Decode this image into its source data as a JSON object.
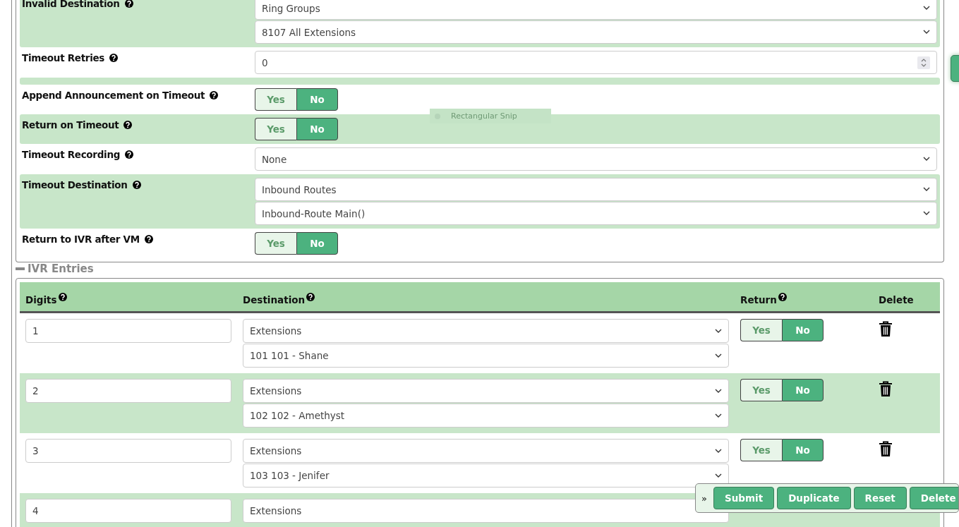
{
  "settings": [
    {
      "kind": "select",
      "label": "Invalid Destination",
      "values": [
        "Ring Groups",
        "8107 All Extensions"
      ]
    },
    {
      "kind": "number",
      "label": "Timeout Retries",
      "value": "0"
    },
    {
      "kind": "blank"
    },
    {
      "kind": "toggle",
      "label": "Append Announcement on Timeout",
      "options": [
        {
          "label": "Yes",
          "selected": false
        },
        {
          "label": "No",
          "selected": true
        }
      ]
    },
    {
      "kind": "toggle",
      "label": "Return on Timeout",
      "options": [
        {
          "label": "Yes",
          "selected": false
        },
        {
          "label": "No",
          "selected": true
        }
      ]
    },
    {
      "kind": "select",
      "label": "Timeout Recording",
      "values": [
        "None"
      ]
    },
    {
      "kind": "select",
      "label": "Timeout Destination",
      "values": [
        "Inbound Routes",
        "Inbound-Route Main()"
      ]
    },
    {
      "kind": "toggle",
      "label": "Return to IVR after VM",
      "options": [
        {
          "label": "Yes",
          "selected": false
        },
        {
          "label": "No",
          "selected": true
        }
      ]
    }
  ],
  "ivr_entries": {
    "title": "IVR Entries",
    "columns": [
      {
        "label": "Digits",
        "help": true
      },
      {
        "label": "Destination",
        "help": true
      },
      {
        "label": "Return",
        "help": true
      },
      {
        "label": "Delete",
        "help": false
      }
    ],
    "rows": [
      {
        "digits": "1",
        "destination": [
          "Extensions",
          "101 101 - Shane"
        ],
        "return": [
          {
            "label": "Yes",
            "selected": false
          },
          {
            "label": "No",
            "selected": true
          }
        ]
      },
      {
        "digits": "2",
        "destination": [
          "Extensions",
          "102 102 - Amethyst"
        ],
        "return": [
          {
            "label": "Yes",
            "selected": false
          },
          {
            "label": "No",
            "selected": true
          }
        ]
      },
      {
        "digits": "3",
        "destination": [
          "Extensions",
          "103 103 - Jenifer"
        ],
        "return": [
          {
            "label": "Yes",
            "selected": false
          },
          {
            "label": "No",
            "selected": true
          }
        ]
      },
      {
        "digits": "4",
        "destination": [
          "Extensions"
        ],
        "return": []
      }
    ]
  },
  "action_bar": {
    "toggle": "»",
    "buttons": [
      "Submit",
      "Duplicate",
      "Reset",
      "Delete"
    ]
  },
  "snip_tooltip": "Rectangular Snip"
}
